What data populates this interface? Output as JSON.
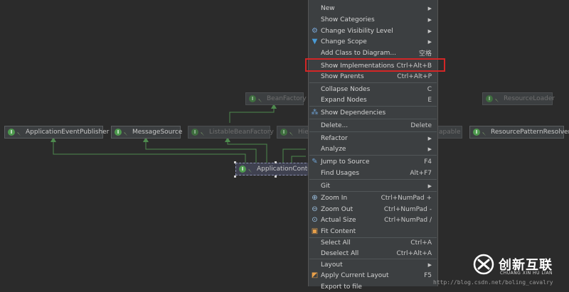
{
  "diagram": {
    "nodes": {
      "bean_factory": "BeanFactory",
      "resource_loader": "ResourceLoader",
      "application_event_publisher": "ApplicationEventPublisher",
      "message_source": "MessageSource",
      "listable_bean_factory": "ListableBeanFactory",
      "hier": "Hier",
      "capable": "apable",
      "resource_pattern_resolver": "ResourcePatternResolver",
      "application_context": "ApplicationConte"
    }
  },
  "context_menu": {
    "items": [
      {
        "label": "New",
        "shortcut": "",
        "submenu": true
      },
      {
        "label": "Show Categories",
        "shortcut": "",
        "submenu": true
      },
      {
        "label": "Change Visibility Level",
        "shortcut": "",
        "submenu": true
      },
      {
        "label": "Change Scope",
        "shortcut": "",
        "submenu": true
      },
      {
        "label": "Add Class to Diagram...",
        "shortcut": "空格",
        "submenu": false
      },
      {
        "label": "Show Implementations",
        "shortcut": "Ctrl+Alt+B",
        "submenu": false
      },
      {
        "label": "Show Parents",
        "shortcut": "Ctrl+Alt+P",
        "submenu": false
      },
      {
        "label": "Collapse Nodes",
        "shortcut": "C",
        "submenu": false
      },
      {
        "label": "Expand Nodes",
        "shortcut": "E",
        "submenu": false
      },
      {
        "label": "Show Dependencies",
        "shortcut": "",
        "submenu": false
      },
      {
        "label": "Delete...",
        "shortcut": "Delete",
        "submenu": false
      },
      {
        "label": "Refactor",
        "shortcut": "",
        "submenu": true
      },
      {
        "label": "Analyze",
        "shortcut": "",
        "submenu": true
      },
      {
        "label": "Jump to Source",
        "shortcut": "F4",
        "submenu": false
      },
      {
        "label": "Find Usages",
        "shortcut": "Alt+F7",
        "submenu": false
      },
      {
        "label": "Git",
        "shortcut": "",
        "submenu": true
      },
      {
        "label": "Zoom In",
        "shortcut": "Ctrl+NumPad +",
        "submenu": false
      },
      {
        "label": "Zoom Out",
        "shortcut": "Ctrl+NumPad -",
        "submenu": false
      },
      {
        "label": "Actual Size",
        "shortcut": "Ctrl+NumPad /",
        "submenu": false
      },
      {
        "label": "Fit Content",
        "shortcut": "",
        "submenu": false
      },
      {
        "label": "Select All",
        "shortcut": "Ctrl+A",
        "submenu": false
      },
      {
        "label": "Deselect All",
        "shortcut": "Ctrl+Alt+A",
        "submenu": false
      },
      {
        "label": "Layout",
        "shortcut": "",
        "submenu": true
      },
      {
        "label": "Apply Current Layout",
        "shortcut": "F5",
        "submenu": false
      },
      {
        "label": "Export to file",
        "shortcut": "",
        "submenu": false
      }
    ]
  },
  "watermark": "http://blog.csdn.net/boling_cavalry",
  "logo": {
    "cn": "创新互联",
    "en": "CHUANG XIN HU LIAN"
  },
  "colors": {
    "highlight_box": "#d32626",
    "menu_bg": "#3c3f41",
    "canvas_bg": "#2b2b2b"
  }
}
